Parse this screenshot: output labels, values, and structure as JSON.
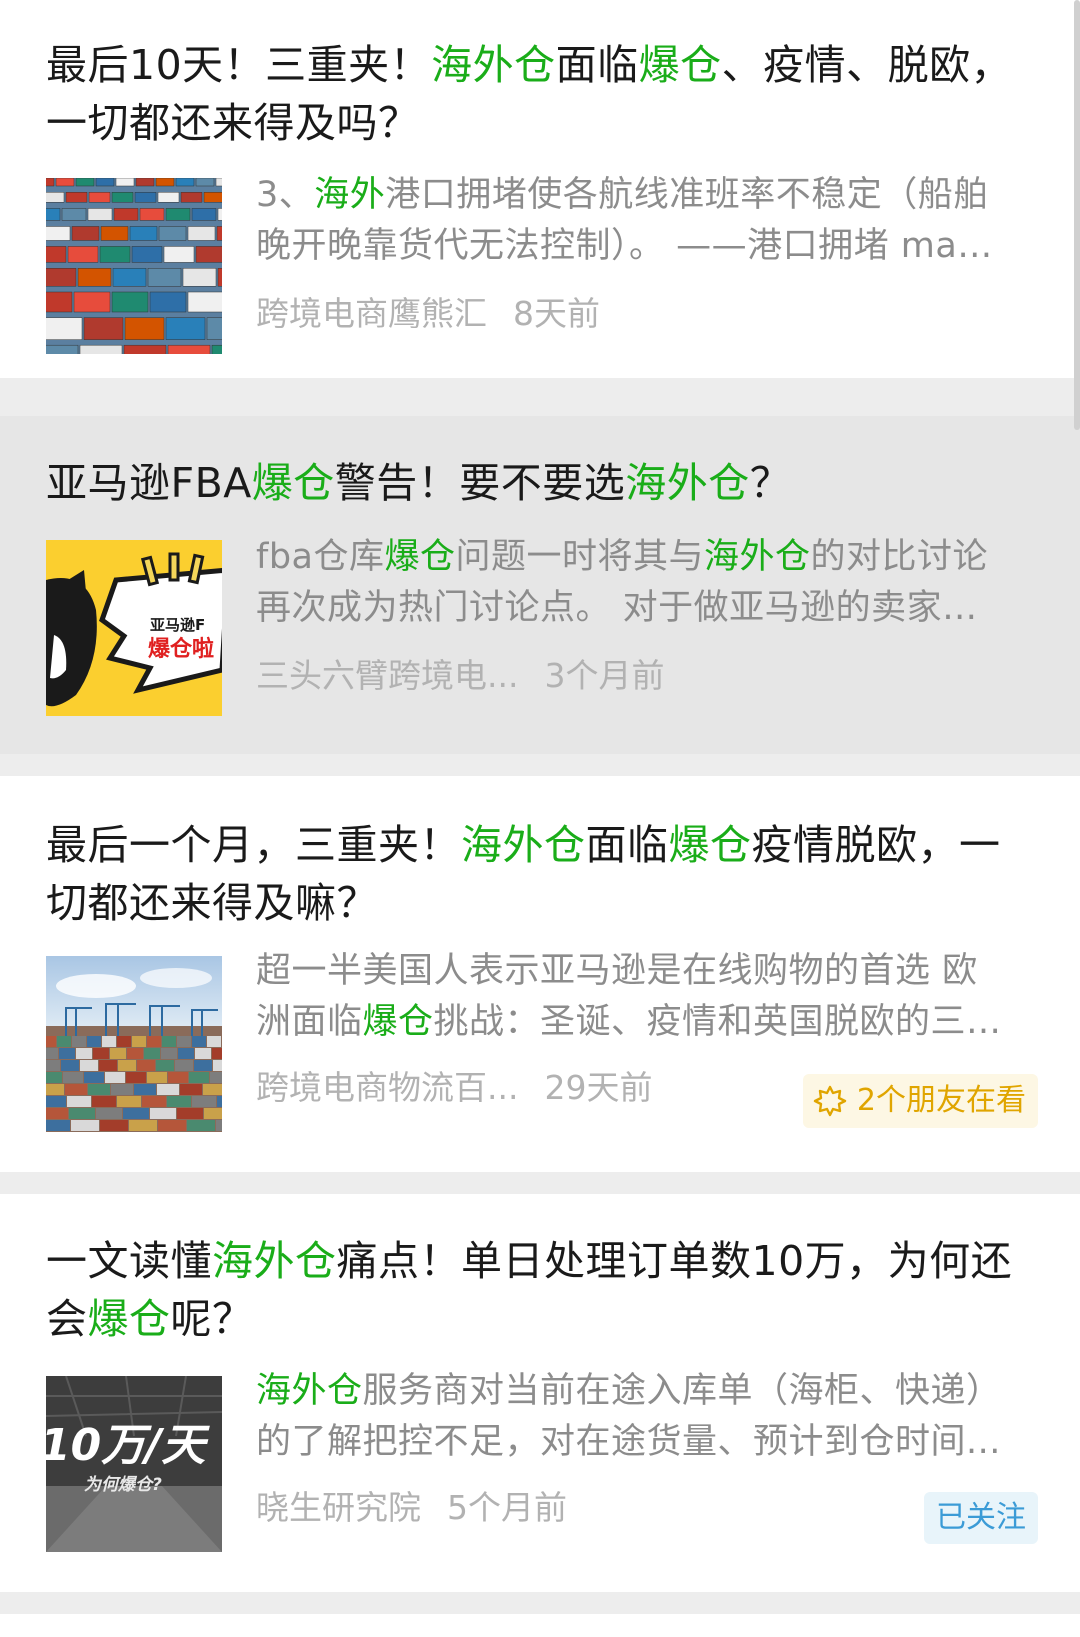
{
  "colors": {
    "highlight": "#1aad19",
    "title": "#1a1a1a",
    "snippet": "#8c8c8c",
    "meta": "#b2b2b2",
    "friends_badge": "#e0a500",
    "followed_badge": "#3b9bd6"
  },
  "results": [
    {
      "title": [
        {
          "t": "最后10天！三重夹！",
          "hl": false
        },
        {
          "t": "海外仓",
          "hl": true
        },
        {
          "t": "面临",
          "hl": false
        },
        {
          "t": "爆仓",
          "hl": true
        },
        {
          "t": "、疫情、脱欧，一切都还来得及吗？",
          "hl": false
        }
      ],
      "snippet_lines": [
        [
          {
            "t": "3、",
            "hl": false
          },
          {
            "t": "海外",
            "hl": true
          },
          {
            "t": "港口拥堵使各航线准班率不稳定（船舶",
            "hl": false
          }
        ],
        [
          {
            "t": "晚开晚靠货代无法控制）。 ——港口拥堵 ma…",
            "hl": false
          }
        ]
      ],
      "source": "跨境电商鹰熊汇",
      "time": "8天前",
      "thumb_icon": "shipping-containers-image"
    },
    {
      "title": [
        {
          "t": "亚马逊FBA",
          "hl": false
        },
        {
          "t": "爆仓",
          "hl": true
        },
        {
          "t": "警告！要不要选",
          "hl": false
        },
        {
          "t": "海外仓",
          "hl": true
        },
        {
          "t": "？",
          "hl": false
        }
      ],
      "snippet_lines": [
        [
          {
            "t": "fba仓库",
            "hl": false
          },
          {
            "t": "爆仓",
            "hl": true
          },
          {
            "t": "问题一时将其与",
            "hl": false
          },
          {
            "t": "海外仓",
            "hl": true
          },
          {
            "t": "的对比讨论",
            "hl": false
          }
        ],
        [
          {
            "t": "再次成为热门讨论点。 对于做亚马逊的卖家…",
            "hl": false
          }
        ]
      ],
      "source": "三头六臂跨境电...",
      "time": "3个月前",
      "thumb_text_1": "亚马逊F",
      "thumb_text_2": "爆仓啦"
    },
    {
      "title": [
        {
          "t": "最后一个月，三重夹！",
          "hl": false
        },
        {
          "t": "海外仓",
          "hl": true
        },
        {
          "t": "面临",
          "hl": false
        },
        {
          "t": "爆仓",
          "hl": true
        },
        {
          "t": "疫情脱欧，一切都还来得及嘛？",
          "hl": false
        }
      ],
      "snippet_lines": [
        [
          {
            "t": "超一半美国人表示亚马逊是在线购物的首选 欧",
            "hl": false
          }
        ],
        [
          {
            "t": "洲面临",
            "hl": false
          },
          {
            "t": "爆仓",
            "hl": true
          },
          {
            "t": "挑战：圣诞、疫情和英国脱欧的三…",
            "hl": false
          }
        ]
      ],
      "source": "跨境电商物流百...",
      "time": "29天前",
      "badge": "2个朋友在看",
      "thumb_icon": "port-cranes-image"
    },
    {
      "title": [
        {
          "t": "一文读懂",
          "hl": false
        },
        {
          "t": "海外仓",
          "hl": true
        },
        {
          "t": "痛点！单日处理订单数10万，为何还会",
          "hl": false
        },
        {
          "t": "爆仓",
          "hl": true
        },
        {
          "t": "呢？",
          "hl": false
        }
      ],
      "snippet_lines": [
        [
          {
            "t": "海外仓",
            "hl": true
          },
          {
            "t": "服务商对当前在途入库单（海柜、快递）",
            "hl": false
          }
        ],
        [
          {
            "t": "的了解把控不足，对在途货量、预计到仓时间...",
            "hl": false
          }
        ]
      ],
      "source": "晓生研究院",
      "time": "5个月前",
      "followed": "已关注",
      "thumb_text_1": "10万/天",
      "thumb_text_2": "为何爆仓?"
    }
  ]
}
